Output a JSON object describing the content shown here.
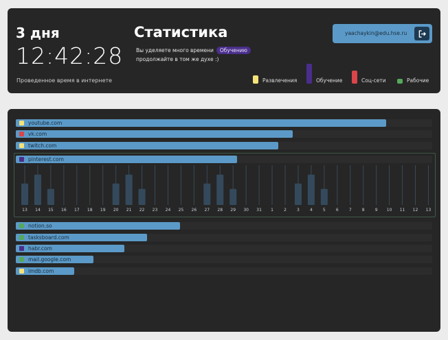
{
  "header": {
    "days": "3 дня",
    "clock": "12:42:28",
    "online_label": "Проведенное время в интернете",
    "stat_title": "Статистика",
    "stat_text_before": "Вы уделяете много времени",
    "stat_tag": "Обучению",
    "stat_text_after": "продолжайте в том же духе :)",
    "user_email": "yaachaykin@edu.hse.ru",
    "logout_icon": "logout-icon"
  },
  "categories": [
    {
      "key": "ent",
      "label": "Развлечения",
      "color": "#f5e27a",
      "share": 0.21
    },
    {
      "key": "edu",
      "label": "Обучение",
      "color": "#4b2d8c",
      "share": 0.5
    },
    {
      "key": "soc",
      "label": "Соц-сети",
      "color": "#d9454a",
      "share": 0.32
    },
    {
      "key": "work",
      "label": "Рабочие",
      "color": "#56a85a",
      "share": 0.08
    }
  ],
  "sites": [
    {
      "name": "youtube.com",
      "category": "ent",
      "share": 0.89
    },
    {
      "name": "vk.com",
      "category": "soc",
      "share": 0.665
    },
    {
      "name": "twitch.com",
      "category": "ent",
      "share": 0.63
    },
    {
      "name": "pinterest.com",
      "category": "edu",
      "share": 0.532,
      "expanded": true
    },
    {
      "name": "notion.so",
      "category": "work",
      "share": 0.395
    },
    {
      "name": "tasksboard.com",
      "category": "work",
      "share": 0.315
    },
    {
      "name": "habr.com",
      "category": "edu",
      "share": 0.26
    },
    {
      "name": "mail.google.com",
      "category": "work",
      "share": 0.187
    },
    {
      "name": "imdb.com",
      "category": "ent",
      "share": 0.14
    }
  ],
  "timeline": {
    "dates": [
      "13",
      "14",
      "15",
      "16",
      "17",
      "18",
      "19",
      "20",
      "21",
      "22",
      "23",
      "24",
      "25",
      "26",
      "27",
      "28",
      "29",
      "30",
      "31",
      "1",
      "2",
      "3",
      "4",
      "5",
      "6",
      "7",
      "8",
      "9",
      "10",
      "11",
      "12",
      "13"
    ],
    "values": [
      0.6,
      0.85,
      0.45,
      0,
      0,
      0,
      0,
      0.6,
      0.85,
      0.45,
      0,
      0,
      0,
      0,
      0.6,
      0.85,
      0.45,
      0,
      0,
      0,
      0,
      0.6,
      0.85,
      0.45,
      0,
      0,
      0,
      0,
      0,
      0,
      0,
      0
    ]
  }
}
